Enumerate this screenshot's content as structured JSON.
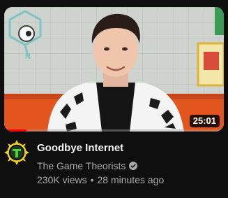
{
  "video": {
    "title": "Goodbye Internet",
    "duration": "25:01",
    "watch_progress_fraction": 0.1,
    "channel": {
      "name": "The Game Theorists",
      "verified": true,
      "avatar_icon": "game-theory-logo-icon"
    },
    "views": "230K views",
    "separator": "•",
    "published": "28 minutes ago"
  },
  "colors": {
    "background": "#0f0f0f",
    "title_text": "#f1f1f1",
    "secondary_text": "#aaaaaa",
    "progress": "#ff0000",
    "avatar_ring": "#f2d21b",
    "avatar_symbol": "#4cd137"
  }
}
